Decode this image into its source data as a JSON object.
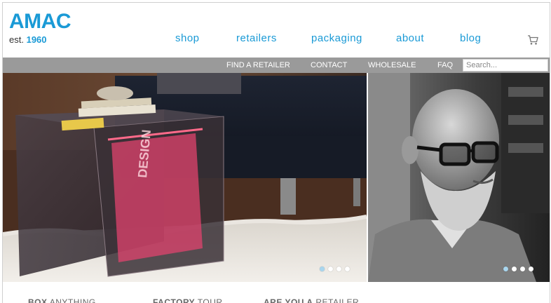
{
  "brand": {
    "name": "AMAC",
    "est_label": "est.",
    "est_year": "1960",
    "color": "#1a9ad6"
  },
  "main_nav": {
    "shop": "shop",
    "retailers": "retailers",
    "packaging": "packaging",
    "about": "about",
    "blog": "blog"
  },
  "cart": {
    "icon": "cart-icon"
  },
  "sub_nav": {
    "find_retailer": "FIND A RETAILER",
    "contact": "CONTACT",
    "wholesale": "WHOLESALE",
    "faq": "FAQ",
    "search_placeholder": "Search..."
  },
  "hero": {
    "left_slider": {
      "dots": 4,
      "active": 1
    },
    "right_slider": {
      "dots": 4,
      "active": 1
    },
    "book_title": "DESIGN NOW"
  },
  "promos": [
    {
      "bold": "BOX",
      "rest": " ANYTHING"
    },
    {
      "bold": "FACTORY",
      "rest": " TOUR"
    },
    {
      "bold": "ARE YOU A",
      "rest": " RETAILER"
    }
  ]
}
